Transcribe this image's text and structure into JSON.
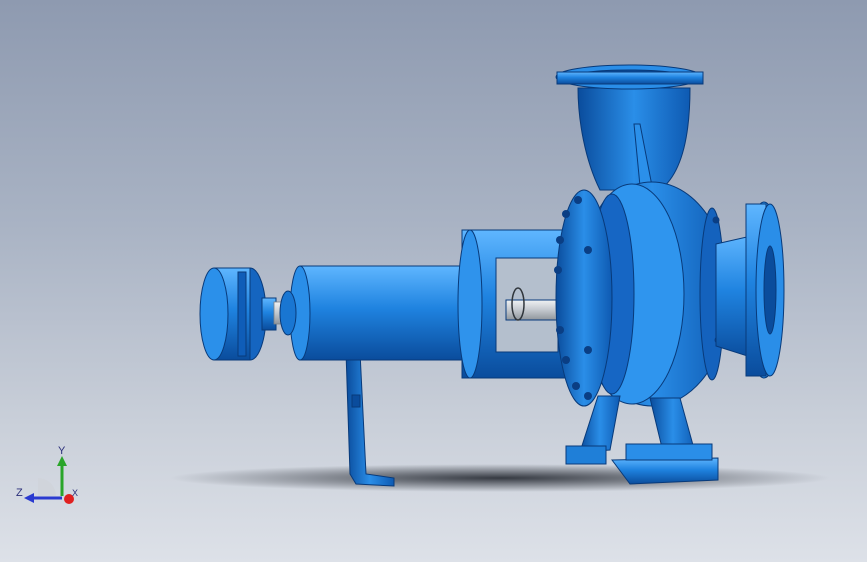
{
  "viewport": {
    "background_top": "#8e9ab0",
    "background_bottom": "#dde1e8",
    "model_color": "#1f7fd8",
    "model_dark": "#0a4ea0",
    "shaft_color": "#c8ccd2"
  },
  "triad": {
    "x_label": "X",
    "y_label": "Y",
    "z_label": "Z",
    "x_color": "#e02020",
    "y_color": "#2aa52a",
    "z_color": "#2a3ad0"
  }
}
